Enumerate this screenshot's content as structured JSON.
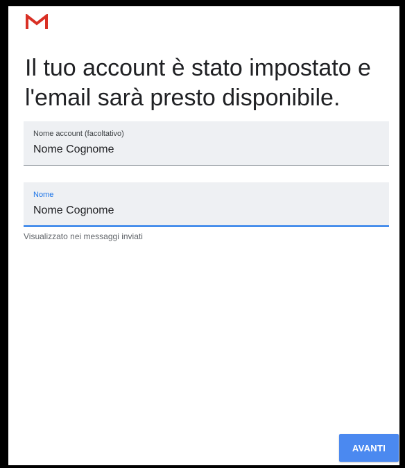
{
  "app": {
    "logo_icon": "gmail-logo-icon",
    "logo_color": "#d93025"
  },
  "header": {
    "title": "Il tuo account è stato impostato e l'email sarà presto disponibile."
  },
  "form": {
    "account_name": {
      "label": "Nome account (facoltativo)",
      "value": "Nome Cognome"
    },
    "name": {
      "label": "Nome",
      "value": "Nome Cognome",
      "helper": "Visualizzato nei messaggi inviati"
    }
  },
  "footer": {
    "next_label": "AVANTI"
  },
  "colors": {
    "accent": "#1a73e8",
    "button": "#4b89f0",
    "field_bg": "#eef0f3"
  }
}
